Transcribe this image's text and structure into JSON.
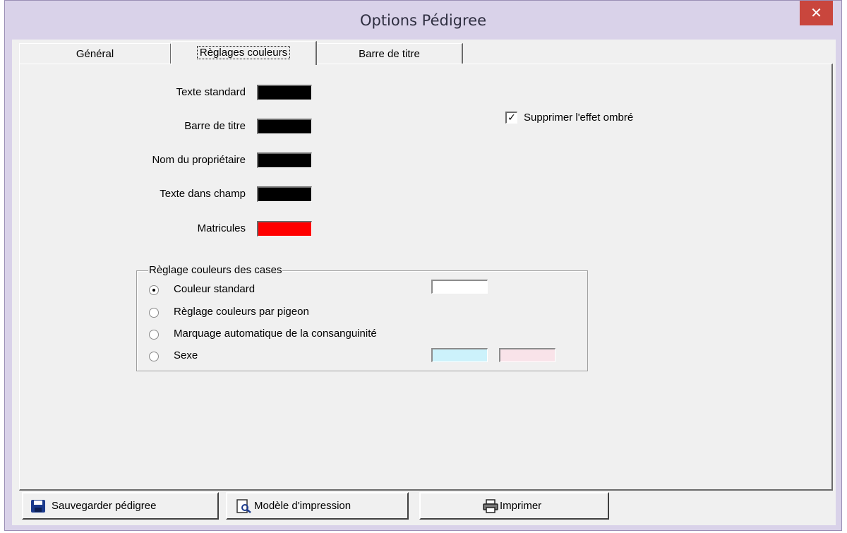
{
  "window": {
    "title": "Options Pédigree",
    "close_label": "✕"
  },
  "tabs": [
    {
      "label": "Général",
      "active": false
    },
    {
      "label": "Règlages couleurs",
      "active": true
    },
    {
      "label": "Barre de titre",
      "active": false
    }
  ],
  "colors": {
    "rows": [
      {
        "label": "Texte standard",
        "color": "#000000"
      },
      {
        "label": "Barre de titre",
        "color": "#000000"
      },
      {
        "label": "Nom du propriétaire",
        "color": "#000000"
      },
      {
        "label": "Texte dans champ",
        "color": "#000000"
      },
      {
        "label": "Matricules",
        "color": "#ff0000"
      }
    ]
  },
  "shadow_checkbox": {
    "label": "Supprimer l'effet ombré",
    "checked": true
  },
  "box_colors": {
    "title": "Règlage couleurs des cases",
    "options": [
      {
        "label": "Couleur standard",
        "selected": true
      },
      {
        "label": "Règlage couleurs par pigeon",
        "selected": false
      },
      {
        "label": "Marquage automatique de la consanguinité",
        "selected": false
      },
      {
        "label": "Sexe",
        "selected": false
      }
    ],
    "standard_color": "#ffffff",
    "male_color": "#ccf2fb",
    "female_color": "#f9e3e9"
  },
  "buttons": {
    "save": "Sauvegarder pédigree",
    "template": "Modèle d'impression",
    "print": "Imprimer"
  }
}
